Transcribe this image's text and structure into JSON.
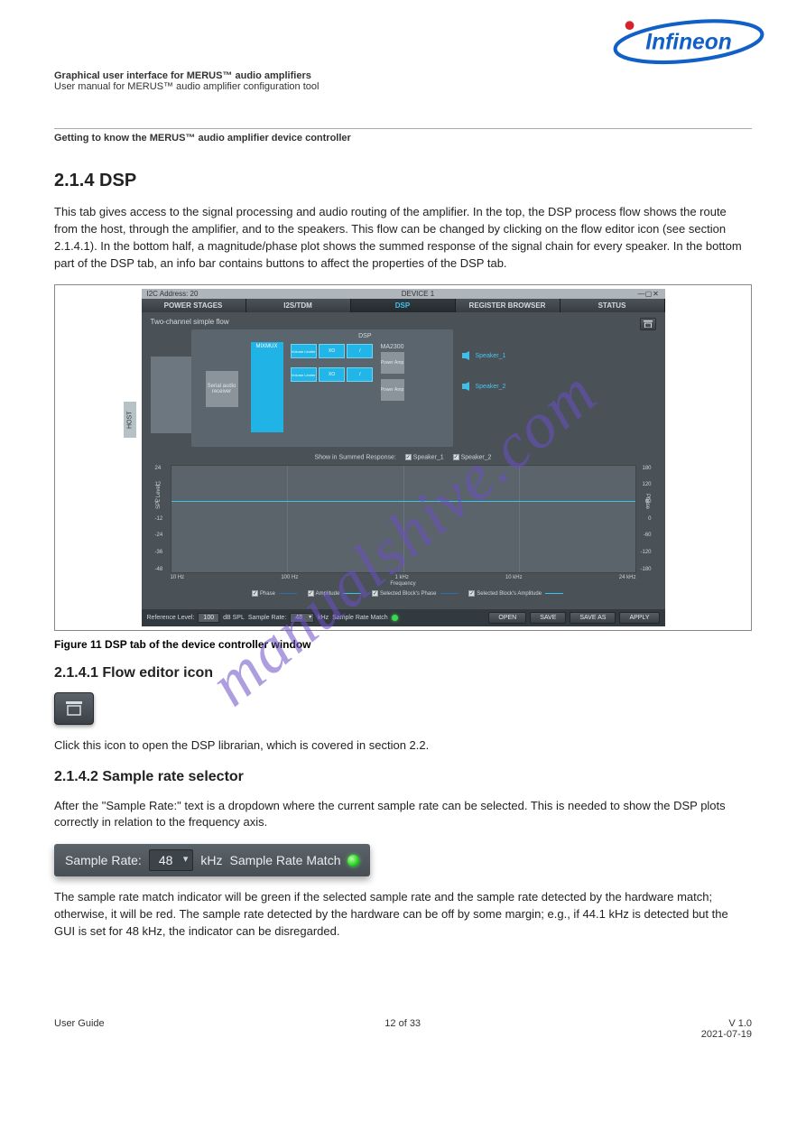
{
  "watermark": "manualshive.com",
  "logo_text": "Infineon",
  "header": {
    "line1": "Graphical user interface for MERUS™ audio amplifiers",
    "line2": "User manual for MERUS™ audio amplifier configuration tool",
    "line3": "Getting to know the MERUS™ audio amplifier device controller"
  },
  "section_title": "2.1.4            DSP",
  "body_p1": "This tab gives access to the signal processing and audio routing of the amplifier. In the top, the DSP process flow shows the route from the host, through the amplifier, and to the speakers. This flow can be changed by clicking on the flow editor icon (see section 2.1.4.1). In the bottom half, a magnitude/phase plot shows the summed response of the signal chain for every speaker. In the bottom part of the DSP tab, an info bar contains buttons to affect the properties of the DSP tab.",
  "screenshot": {
    "titlebar_left": "I2C Address: 20",
    "titlebar_center": "DEVICE 1",
    "tabs": [
      "POWER STAGES",
      "I2S/TDM",
      "DSP",
      "REGISTER BROWSER",
      "STATUS"
    ],
    "flow_title": "Two-channel simple flow",
    "host": "HOST",
    "serial_audio": "Serial audio receiver",
    "mixmux": "MIXMUX",
    "dsp_label": "DSP",
    "ma_label": "MA2300",
    "power_amp": "Power Amp",
    "volume_limiter": "Volume Limiter",
    "xo": "XO",
    "speakers": [
      "Speaker_1",
      "Speaker_2"
    ],
    "summed_label": "Show in Summed Response:",
    "chart_y_left": [
      "24",
      "12",
      "0",
      "-12",
      "-24",
      "-36",
      "-48"
    ],
    "chart_y_right": [
      "180",
      "120",
      "60",
      "0",
      "-60",
      "-120",
      "-180"
    ],
    "chart_x": [
      "10 Hz",
      "100 Hz",
      "1 kHz",
      "10 kHz",
      "24 kHz"
    ],
    "axis_left": "SPL Level",
    "axis_right": "Phase",
    "axis_bottom": "Frequency",
    "legend": {
      "phase": "Phase",
      "amplitude": "Amplitude",
      "sel_phase": "Selected Block's Phase",
      "sel_amp": "Selected Block's Amplitude"
    },
    "bottombar": {
      "ref_label": "Reference Level:",
      "ref_val": "100",
      "ref_unit": "dB SPL",
      "sr_label": "Sample Rate:",
      "sr_val": "48",
      "sr_unit": "kHz",
      "sr_match": "Sample Rate Match",
      "buttons": [
        "OPEN",
        "SAVE",
        "SAVE AS",
        "APPLY"
      ]
    }
  },
  "figure_caption": "Figure 11         DSP tab of the device controller window",
  "sub1_title": "2.1.4.1              Flow editor icon",
  "sub1_body": "Click this icon to open the DSP librarian, which is covered in section 2.2.",
  "sub2_title": "2.1.4.2              Sample rate selector",
  "sub2_body1": "After the \"Sample Rate:\" text is a dropdown where the current sample rate can be selected. This is needed to show the DSP plots correctly in relation to the frequency axis.",
  "sub2_body2": "The sample rate match indicator will be green if the selected sample rate and the sample rate detected by the hardware match; otherwise, it will be red. The sample rate detected by the hardware can be off by some margin; e.g., if 44.1 kHz is detected but the GUI is set for 48 kHz, the indicator can be disregarded.",
  "sample_rate_bar": {
    "label": "Sample Rate:",
    "value": "48",
    "unit": "kHz",
    "match": "Sample Rate Match"
  },
  "chart_data": {
    "type": "line",
    "title": "Summed Response",
    "xlabel": "Frequency",
    "ylabel_left": "SPL Level",
    "ylabel_right": "Phase",
    "x_scale": "log",
    "xlim_hz": [
      10,
      24000
    ],
    "ylim_left_db": [
      -48,
      24
    ],
    "ylim_right_deg": [
      -180,
      180
    ],
    "x_ticks_hz": [
      10,
      100,
      1000,
      10000,
      24000
    ],
    "series": [
      {
        "name": "Speaker_1 Amplitude",
        "axis": "left",
        "x_hz": [
          10,
          24000
        ],
        "y": [
          0,
          0
        ]
      },
      {
        "name": "Speaker_2 Amplitude",
        "axis": "left",
        "x_hz": [
          10,
          24000
        ],
        "y": [
          0,
          0
        ]
      },
      {
        "name": "Speaker_1 Phase",
        "axis": "right",
        "x_hz": [
          10,
          24000
        ],
        "y": [
          0,
          0
        ]
      },
      {
        "name": "Speaker_2 Phase",
        "axis": "right",
        "x_hz": [
          10,
          24000
        ],
        "y": [
          0,
          0
        ]
      }
    ]
  },
  "footer": {
    "left": "User Guide",
    "center": "12 of 33",
    "right_line1": "V 1.0",
    "right_line2": "2021-07-19"
  }
}
